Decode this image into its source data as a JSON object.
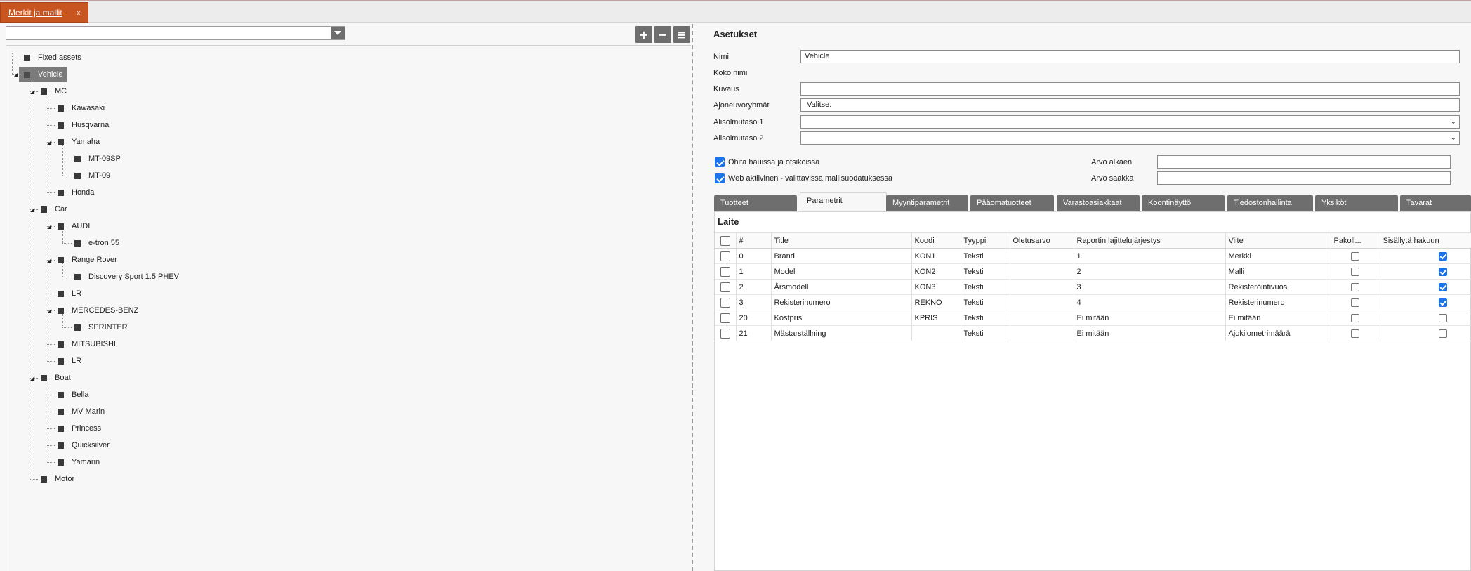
{
  "doc_tab": {
    "label": "Merkit ja mallit",
    "close": "x"
  },
  "toolbar": {
    "add": "+",
    "remove": "−",
    "menu": "≡"
  },
  "tree": [
    {
      "label": "Fixed assets",
      "level": 0
    },
    {
      "label": "Vehicle",
      "level": 0,
      "selected": true
    },
    {
      "label": "MC",
      "level": 1
    },
    {
      "label": "Kawasaki",
      "level": 2
    },
    {
      "label": "Husqvarna",
      "level": 2
    },
    {
      "label": "Yamaha",
      "level": 2
    },
    {
      "label": "MT-09SP",
      "level": 3
    },
    {
      "label": "MT-09",
      "level": 3
    },
    {
      "label": "Honda",
      "level": 2
    },
    {
      "label": "Car",
      "level": 1
    },
    {
      "label": "AUDI",
      "level": 2
    },
    {
      "label": "e-tron 55",
      "level": 3
    },
    {
      "label": "Range Rover",
      "level": 2
    },
    {
      "label": "Discovery Sport 1.5 PHEV",
      "level": 3
    },
    {
      "label": "LR",
      "level": 2
    },
    {
      "label": "MERCEDES-BENZ",
      "level": 2
    },
    {
      "label": "SPRINTER",
      "level": 3
    },
    {
      "label": "MITSUBISHI",
      "level": 2
    },
    {
      "label": "LR",
      "level": 2
    },
    {
      "label": "Boat",
      "level": 1
    },
    {
      "label": "Bella",
      "level": 2
    },
    {
      "label": "MV Marin",
      "level": 2
    },
    {
      "label": "Princess",
      "level": 2
    },
    {
      "label": "Quicksilver",
      "level": 2
    },
    {
      "label": "Yamarin",
      "level": 2
    },
    {
      "label": "Motor",
      "level": 1
    }
  ],
  "settings": {
    "title": "Asetukset",
    "fields": {
      "nimi_label": "Nimi",
      "nimi_value": "Vehicle",
      "koko_nimi_label": "Koko nimi",
      "kuvaus_label": "Kuvaus",
      "kuvaus_value": "",
      "ajoneuvoryhmat_label": "Ajoneuvoryhmät",
      "ajoneuvoryhmat_value": "Valitse:",
      "alisolmutaso1_label": "Alisolmutaso 1",
      "alisolmutaso1_value": "",
      "alisolmutaso2_label": "Alisolmutaso 2",
      "alisolmutaso2_value": ""
    },
    "checkboxes": {
      "ohita_label": "Ohita hauissa ja otsikoissa",
      "ohita_checked": true,
      "web_label": "Web aktiivinen - valittavissa mallisuodatuksessa",
      "web_checked": true
    },
    "arvo": {
      "alkaen_label": "Arvo alkaen",
      "alkaen_value": "",
      "saakka_label": "Arvo saakka",
      "saakka_value": ""
    }
  },
  "tabs": [
    {
      "label": "Tuotteet",
      "active": false
    },
    {
      "label": "Parametrit",
      "active": true
    },
    {
      "label": "Myyntiparametrit",
      "active": false
    },
    {
      "label": "Pääomatuotteet",
      "active": false
    },
    {
      "label": "Varastoasiakkaat",
      "active": false
    },
    {
      "label": "Koontinäyttö",
      "active": false
    },
    {
      "label": "Tiedostonhallinta",
      "active": false
    },
    {
      "label": "Yksiköt",
      "active": false
    },
    {
      "label": "Tavarat",
      "active": false
    }
  ],
  "params": {
    "title": "Laite",
    "columns": [
      "#",
      "Title",
      "Koodi",
      "Tyyppi",
      "Oletusarvo",
      "Raportin lajittelujärjestys",
      "Viite",
      "Pakoll...",
      "Sisällytä hakuun"
    ],
    "rows": [
      {
        "num": "0",
        "title": "Brand",
        "code": "KON1",
        "type": "Teksti",
        "default": "",
        "order": "1",
        "ref": "Merkki",
        "mandatory": false,
        "include": true
      },
      {
        "num": "1",
        "title": "Model",
        "code": "KON2",
        "type": "Teksti",
        "default": "",
        "order": "2",
        "ref": "Malli",
        "mandatory": false,
        "include": true
      },
      {
        "num": "2",
        "title": "Årsmodell",
        "code": "KON3",
        "type": "Teksti",
        "default": "",
        "order": "3",
        "ref": "Rekisteröintivuosi",
        "mandatory": false,
        "include": true
      },
      {
        "num": "3",
        "title": "Rekisterinumero",
        "code": "REKNO",
        "type": "Teksti",
        "default": "",
        "order": "4",
        "ref": "Rekisterinumero",
        "mandatory": false,
        "include": true
      },
      {
        "num": "20",
        "title": "Kostpris",
        "code": "KPRIS",
        "type": "Teksti",
        "default": "",
        "order": "Ei mitään",
        "ref": "Ei mitään",
        "mandatory": false,
        "include": false
      },
      {
        "num": "21",
        "title": "Mästarställning",
        "code": "",
        "type": "Teksti",
        "default": "",
        "order": "Ei mitään",
        "ref": "Ajokilometrimäärä",
        "mandatory": false,
        "include": false
      }
    ]
  }
}
